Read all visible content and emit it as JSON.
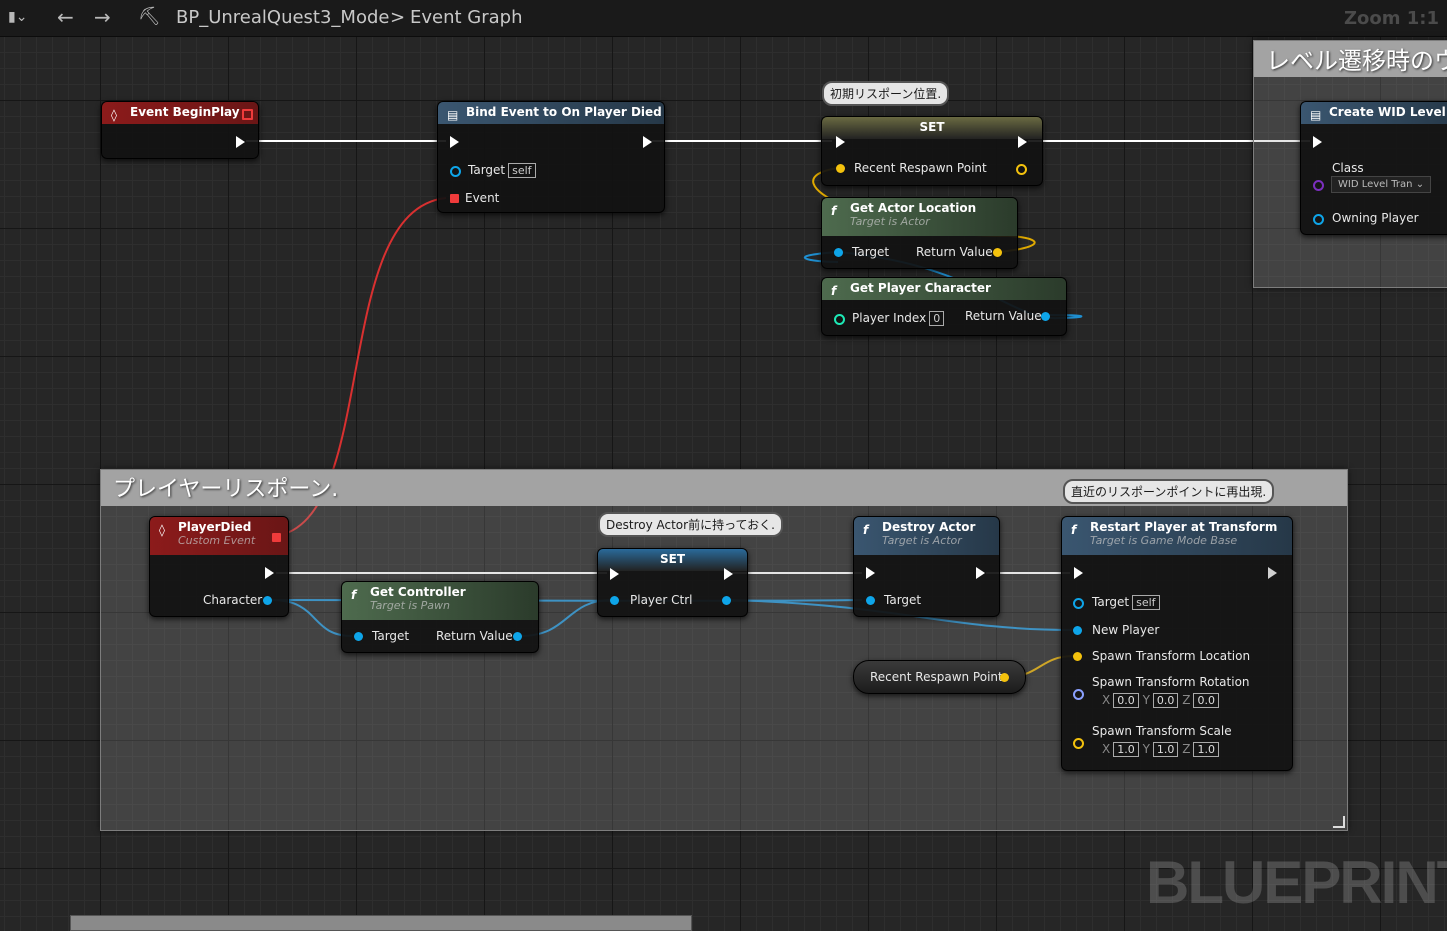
{
  "toolbar": {
    "breadcrumb_blueprint": "BP_UnrealQuest3_Mode",
    "breadcrumb_separator": ">",
    "breadcrumb_graph": "Event Graph",
    "zoom_label": "Zoom 1:1"
  },
  "comments": {
    "level_transition": "レベル遷移時のウ",
    "player_respawn": "プレイヤーリスポーン."
  },
  "bubbles": {
    "initial_respawn": "初期リスポーン位置.",
    "destroy_note": "Destroy Actor前に持っておく.",
    "restart_note": "直近のリスポーンポイントに再出現."
  },
  "nodes": {
    "begin_play": {
      "title": "Event BeginPlay"
    },
    "bind_event": {
      "title": "Bind Event to On Player Died",
      "target_label": "Target",
      "target_default": "self",
      "event_label": "Event"
    },
    "set_top": {
      "title": "SET",
      "var_label": "Recent Respawn Point"
    },
    "get_actor_location": {
      "title": "Get Actor Location",
      "subtitle": "Target is Actor",
      "target_label": "Target",
      "return_label": "Return Value"
    },
    "get_player_character": {
      "title": "Get Player Character",
      "index_label": "Player Index",
      "index_value": "0",
      "return_label": "Return Value"
    },
    "create_widget": {
      "title": "Create WID Level Tra",
      "class_label": "Class",
      "class_value": "WID Level Tran",
      "owner_label": "Owning Player"
    },
    "player_died": {
      "title": "PlayerDied",
      "subtitle": "Custom Event",
      "character_label": "Character"
    },
    "get_controller": {
      "title": "Get Controller",
      "subtitle": "Target is Pawn",
      "target_label": "Target",
      "return_label": "Return Value"
    },
    "set_bottom": {
      "title": "SET",
      "var_label": "Player Ctrl"
    },
    "destroy_actor": {
      "title": "Destroy Actor",
      "subtitle": "Target is Actor",
      "target_label": "Target"
    },
    "recent_respawn_getter": {
      "label": "Recent Respawn Point"
    },
    "restart_player": {
      "title": "Restart Player at Transform",
      "subtitle": "Target is Game Mode Base",
      "target_label": "Target",
      "target_default": "self",
      "new_player_label": "New Player",
      "location_label": "Spawn Transform Location",
      "rotation_label": "Spawn Transform Rotation",
      "rotation_x": "0.0",
      "rotation_y": "0.0",
      "rotation_z": "0.0",
      "scale_label": "Spawn Transform Scale",
      "scale_x": "1.0",
      "scale_y": "1.0",
      "scale_z": "1.0",
      "x": "X",
      "y": "Y",
      "z": "Z"
    }
  },
  "watermark": "BLUEPRINT",
  "colors": {
    "exec": "#ffffff",
    "object_pin": "#0ea5e9",
    "vector_pin": "#f4c20d",
    "delegate_pin": "#ef3b3b",
    "class_pin": "#7b2fbe",
    "event_header": "#8c1b1b",
    "function_header": "#4e6b4e",
    "call_header": "#3a5670"
  }
}
